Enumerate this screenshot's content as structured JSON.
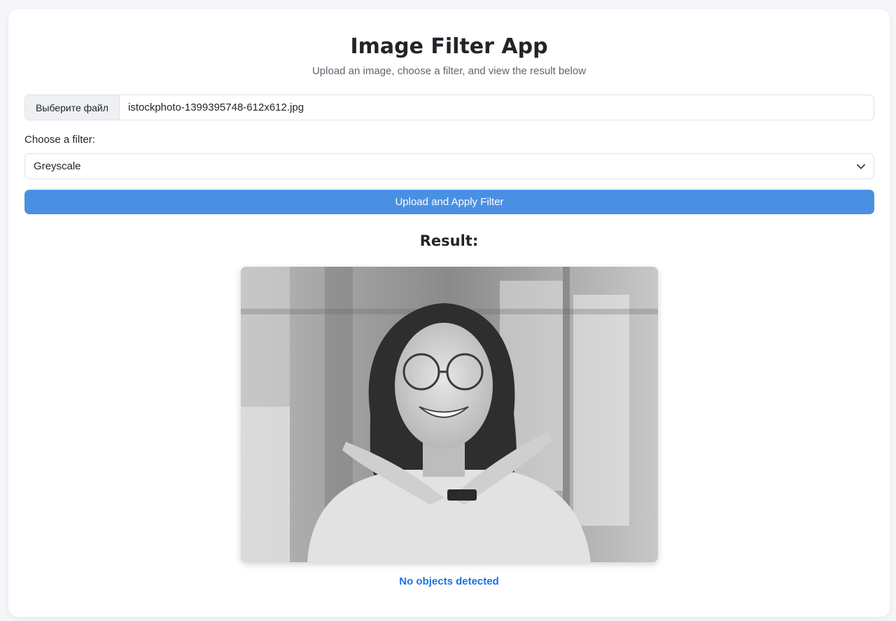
{
  "app": {
    "title": "Image Filter App",
    "subtitle": "Upload an image, choose a filter, and view the result below"
  },
  "file_input": {
    "button_label": "Выберите файл",
    "file_name": "istockphoto-1399395748-612x612.jpg"
  },
  "filter": {
    "label": "Choose a filter:",
    "selected": "Greyscale",
    "icon": "chevron-down-icon"
  },
  "submit": {
    "label": "Upload and Apply Filter"
  },
  "result": {
    "heading": "Result:",
    "status": "No objects detected"
  },
  "colors": {
    "accent": "#4a90e2",
    "status_text": "#1a73e8",
    "background": "#f4f6f9"
  }
}
